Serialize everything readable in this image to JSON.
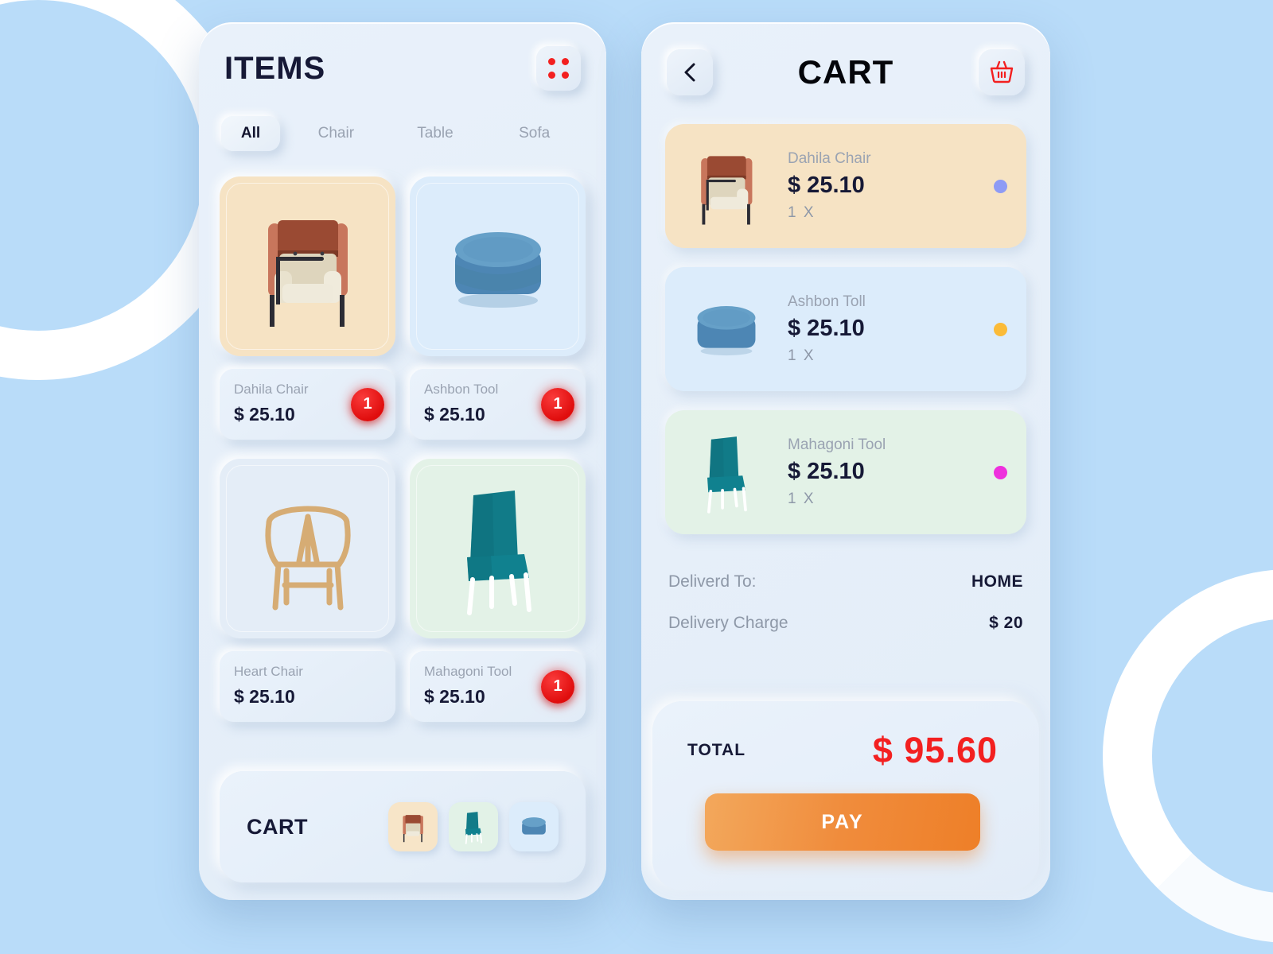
{
  "items_panel": {
    "title": "ITEMS",
    "grid_icon": "grid-dots-icon",
    "tabs": [
      {
        "label": "All",
        "active": true
      },
      {
        "label": "Chair",
        "active": false
      },
      {
        "label": "Table",
        "active": false
      },
      {
        "label": "Sofa",
        "active": false
      }
    ],
    "products": [
      {
        "name": "Dahila Chair",
        "price": "$ 25.10",
        "badge": "1",
        "bg": "beige",
        "image": "armchair"
      },
      {
        "name": "Ashbon Tool",
        "price": "$ 25.10",
        "badge": "1",
        "bg": "blue",
        "image": "ottoman"
      },
      {
        "name": "Heart Chair",
        "price": "$ 25.10",
        "badge": "",
        "bg": "grey",
        "image": "wishbone-chair"
      },
      {
        "name": "Mahagoni Tool",
        "price": "$ 25.10",
        "badge": "1",
        "bg": "green",
        "image": "teal-chair"
      }
    ],
    "cart_strip": {
      "label": "CART",
      "thumbs": [
        "armchair",
        "teal-chair",
        "ottoman"
      ]
    }
  },
  "cart_panel": {
    "back_icon": "chevron-left-icon",
    "title": "CART",
    "basket_icon": "shopping-basket-icon",
    "items": [
      {
        "name": "Dahila Chair",
        "price": "$ 25.10",
        "qty": "1  X",
        "dot_color": "#8e9bf5",
        "bg": "beige",
        "image": "armchair"
      },
      {
        "name": "Ashbon Toll",
        "price": "$ 25.10",
        "qty": "1  X",
        "dot_color": "#fbbb38",
        "bg": "blue",
        "image": "ottoman"
      },
      {
        "name": "Mahagoni Tool",
        "price": "$ 25.10",
        "qty": "1  X",
        "dot_color": "#ee31dd",
        "bg": "green",
        "image": "teal-chair"
      }
    ],
    "delivery": [
      {
        "label": "Deliverd To:",
        "value": "HOME"
      },
      {
        "label": "Delivery Charge",
        "value": "$ 20"
      }
    ],
    "total_label": "TOTAL",
    "total_value": "$ 95.60",
    "pay_label": "PAY"
  },
  "theme": {
    "background": "#b9dcf9",
    "accent_red": "#f32020",
    "accent_orange": "#ee7f28",
    "text_dark": "#161936",
    "text_muted": "#9aa3b2"
  }
}
